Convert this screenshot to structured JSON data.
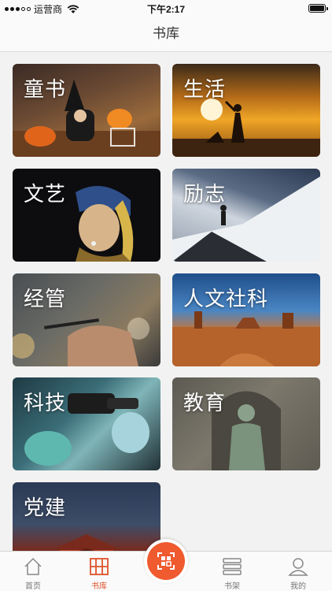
{
  "status_bar": {
    "carrier": "运营商",
    "time": "下午2:17"
  },
  "nav": {
    "title": "书库"
  },
  "categories": [
    {
      "label": "童书",
      "icon": "halloween-kid-photo"
    },
    {
      "label": "生活",
      "icon": "sunset-family-photo"
    },
    {
      "label": "文艺",
      "icon": "pearl-earring-painting"
    },
    {
      "label": "励志",
      "icon": "mountain-climber-photo"
    },
    {
      "label": "经管",
      "icon": "business-pen-photo"
    },
    {
      "label": "人文社科",
      "icon": "desert-monument-photo"
    },
    {
      "label": "科技",
      "icon": "lab-microscope-photo"
    },
    {
      "label": "教育",
      "icon": "statue-relief-photo"
    },
    {
      "label": "党建",
      "icon": "tiananmen-photo"
    }
  ],
  "tabs": {
    "home": "首页",
    "library": "书库",
    "shelf": "书架",
    "mine": "我的"
  },
  "colors": {
    "accent": "#ef5a2e",
    "tab_active": "#e0532b",
    "tab_inactive": "#777777"
  }
}
